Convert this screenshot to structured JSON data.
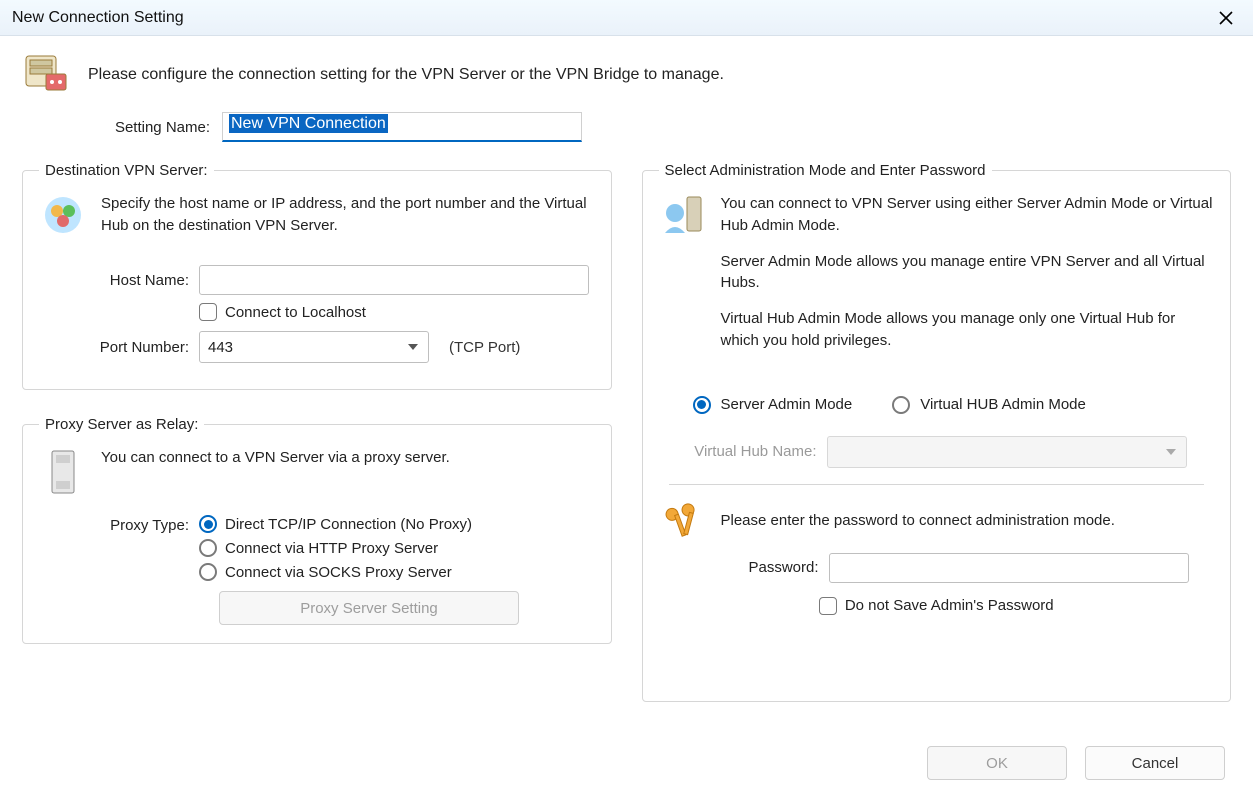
{
  "window": {
    "title": "New Connection Setting"
  },
  "intro": {
    "text": "Please configure the connection setting for the VPN Server or the VPN Bridge to manage."
  },
  "setting_name": {
    "label": "Setting Name:",
    "value": "New VPN Connection"
  },
  "dest": {
    "legend": "Destination VPN Server:",
    "desc": "Specify the host name or IP address, and the port number and the Virtual Hub on the destination VPN Server.",
    "host_label": "Host Name:",
    "host_value": "",
    "connect_localhost": "Connect to Localhost",
    "port_label": "Port Number:",
    "port_value": "443",
    "port_suffix": "(TCP Port)"
  },
  "proxy": {
    "legend": "Proxy Server as Relay:",
    "desc": "You can connect to a VPN Server via a proxy server.",
    "type_label": "Proxy Type:",
    "options": {
      "direct": "Direct TCP/IP Connection (No Proxy)",
      "http": "Connect via HTTP Proxy Server",
      "socks": "Connect via SOCKS Proxy Server"
    },
    "button": "Proxy Server Setting"
  },
  "admin": {
    "legend": "Select Administration Mode and Enter Password",
    "desc1": "You can connect to VPN Server using either Server Admin Mode or Virtual Hub Admin Mode.",
    "desc2": "Server Admin Mode allows you manage entire VPN Server and all Virtual Hubs.",
    "desc3": "Virtual Hub Admin Mode allows you manage only one Virtual Hub for which you hold privileges.",
    "mode_server": "Server Admin Mode",
    "mode_hub": "Virtual HUB Admin Mode",
    "hub_label": "Virtual Hub Name:",
    "hub_value": "",
    "password_prompt": "Please enter the password to connect administration mode.",
    "password_label": "Password:",
    "password_value": "",
    "no_save": "Do not Save Admin's Password"
  },
  "buttons": {
    "ok": "OK",
    "cancel": "Cancel"
  }
}
